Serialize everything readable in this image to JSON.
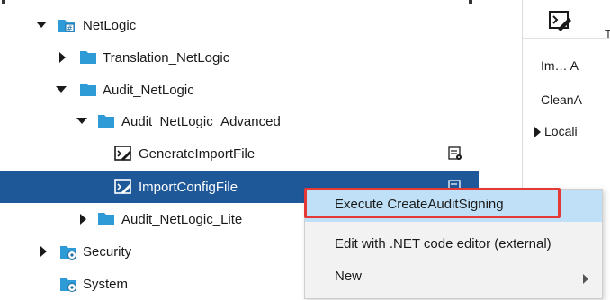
{
  "tree": {
    "items": [
      {
        "label": "NetLogic",
        "icon": "netlogic-folder-icon",
        "expanded": true
      },
      {
        "label": "Translation_NetLogic",
        "icon": "folder-icon",
        "expanded": false
      },
      {
        "label": "Audit_NetLogic",
        "icon": "folder-icon",
        "expanded": true
      },
      {
        "label": "Audit_NetLogic_Advanced",
        "icon": "folder-icon",
        "expanded": true
      },
      {
        "label": "GenerateImportFile",
        "icon": "netlogic-script-icon"
      },
      {
        "label": "ImportConfigFile",
        "icon": "netlogic-script-icon",
        "selected": true
      },
      {
        "label": "Audit_NetLogic_Lite",
        "icon": "folder-icon",
        "expanded": false
      },
      {
        "label": "Security",
        "icon": "security-folder-icon",
        "expanded": false
      },
      {
        "label": "System",
        "icon": "system-folder-icon"
      }
    ]
  },
  "right_panel": {
    "header_letter": "T",
    "rows": [
      {
        "text": "Im…  A"
      },
      {
        "text": "CleanA"
      },
      {
        "text": "Locali"
      }
    ]
  },
  "context_menu": {
    "items": [
      {
        "label": "Execute CreateAuditSigning",
        "highlighted": true
      },
      {
        "label": "Edit with .NET code editor (external)"
      },
      {
        "label": "New",
        "submenu": true
      }
    ]
  },
  "colors": {
    "selection": "#1f5899",
    "menu_highlight": "#bfe0f7",
    "annotation_box": "#e53935",
    "folder": "#2e9bd6"
  }
}
